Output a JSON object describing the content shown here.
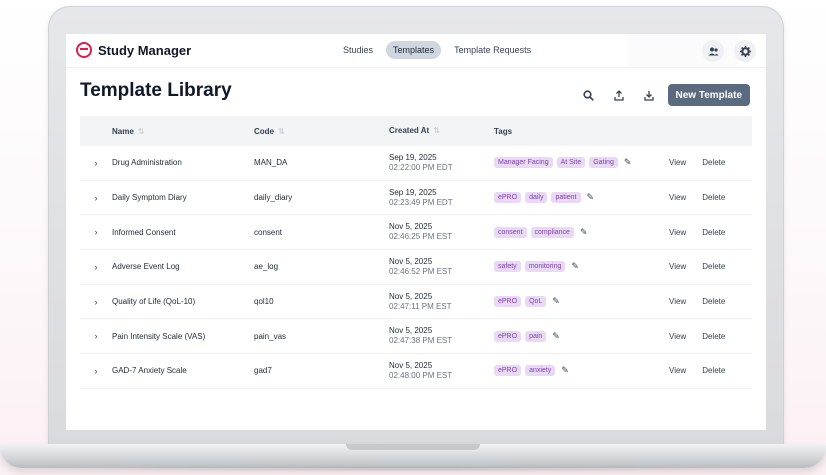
{
  "app": {
    "name": "Study Manager",
    "brand_color": "#e11d48",
    "accent_color": "#5b6b7f"
  },
  "nav": {
    "items": [
      {
        "label": "Studies",
        "active": false
      },
      {
        "label": "Templates",
        "active": true
      },
      {
        "label": "Template Requests",
        "active": false
      }
    ]
  },
  "top_icons": [
    "users-icon",
    "gear-icon"
  ],
  "page": {
    "title": "Template Library",
    "new_button": "New Template",
    "tool_icons": [
      "search-icon",
      "upload-icon",
      "download-icon"
    ]
  },
  "table": {
    "headers": {
      "name": "Name",
      "code": "Code",
      "created": "Created At",
      "tags": "Tags"
    },
    "actions": {
      "view": "View",
      "delete": "Delete"
    },
    "rows": [
      {
        "name": "Drug Administration",
        "code": "MAN_DA",
        "date": "Sep 19, 2025",
        "time": "02:22:00 PM EDT",
        "tags": [
          "Manager Facing",
          "At Site",
          "Gating"
        ]
      },
      {
        "name": "Daily Symptom Diary",
        "code": "daily_diary",
        "date": "Sep 19, 2025",
        "time": "02:23:49 PM EDT",
        "tags": [
          "ePRO",
          "daily",
          "patient"
        ]
      },
      {
        "name": "Informed Consent",
        "code": "consent",
        "date": "Nov 5, 2025",
        "time": "02:46:25 PM EST",
        "tags": [
          "consent",
          "compliance"
        ]
      },
      {
        "name": "Adverse Event Log",
        "code": "ae_log",
        "date": "Nov 5, 2025",
        "time": "02:46:52 PM EST",
        "tags": [
          "safety",
          "monitoring"
        ]
      },
      {
        "name": "Quality of Life (QoL-10)",
        "code": "qol10",
        "date": "Nov 5, 2025",
        "time": "02:47:11 PM EST",
        "tags": [
          "ePRO",
          "QoL"
        ]
      },
      {
        "name": "Pain Intensity Scale (VAS)",
        "code": "pain_vas",
        "date": "Nov 5, 2025",
        "time": "02:47:38 PM EST",
        "tags": [
          "ePRO",
          "pain"
        ]
      },
      {
        "name": "GAD-7 Anxiety Scale",
        "code": "gad7",
        "date": "Nov 5, 2025",
        "time": "02:48:00 PM EST",
        "tags": [
          "ePRO",
          "anxiety"
        ]
      }
    ]
  }
}
